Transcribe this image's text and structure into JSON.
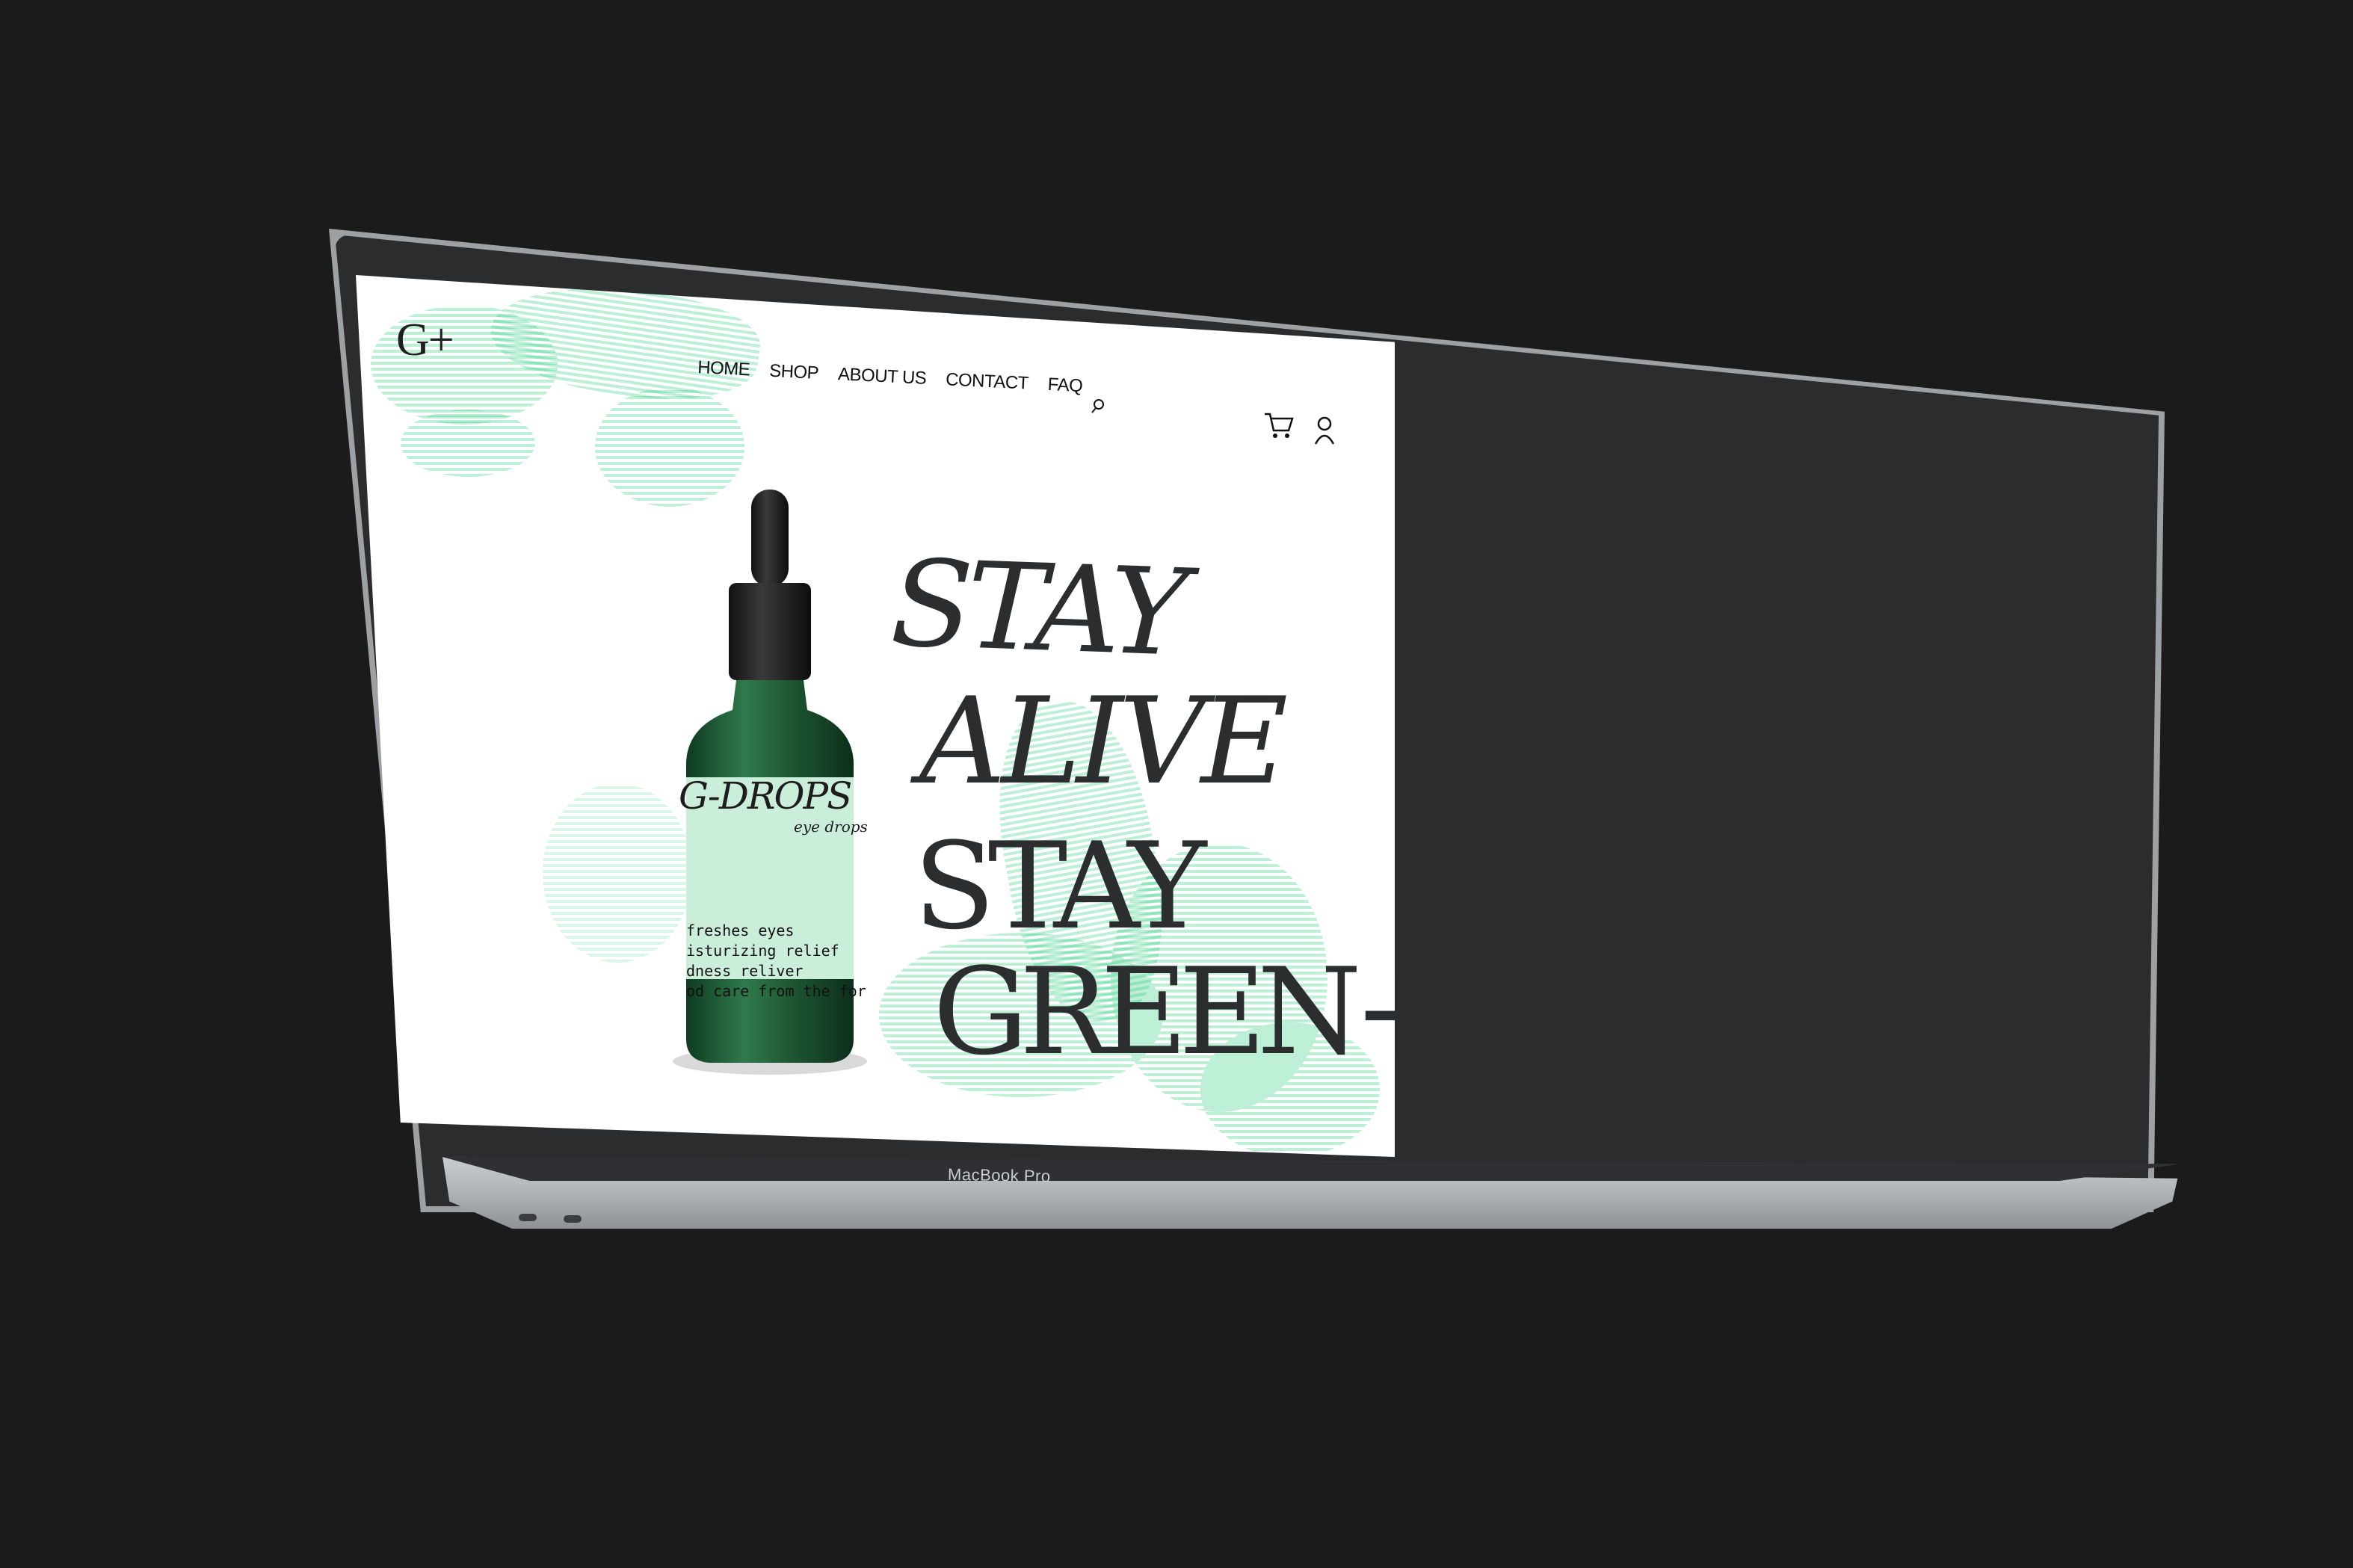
{
  "site": {
    "logo": "G+",
    "nav": [
      {
        "label": "HOME"
      },
      {
        "label": "SHOP"
      },
      {
        "label": "ABOUT US"
      },
      {
        "label": "CONTACT"
      },
      {
        "label": "FAQ"
      }
    ],
    "icons": {
      "search": "search-icon",
      "cart": "cart-icon",
      "user": "user-icon"
    }
  },
  "hero": {
    "headline_lines": [
      "STAY",
      "ALIVE",
      "STAY",
      "GREEN+"
    ],
    "product": {
      "name": "G-DROPS",
      "subtitle": "eye drops",
      "features": [
        "freshes eyes",
        "isturizing relief",
        "dness reliver",
        "od care from the for"
      ]
    },
    "accent_color": "#2ecc80",
    "bottle_color": "#1f5a34"
  },
  "device": {
    "brand_label": "MacBook Pro"
  }
}
